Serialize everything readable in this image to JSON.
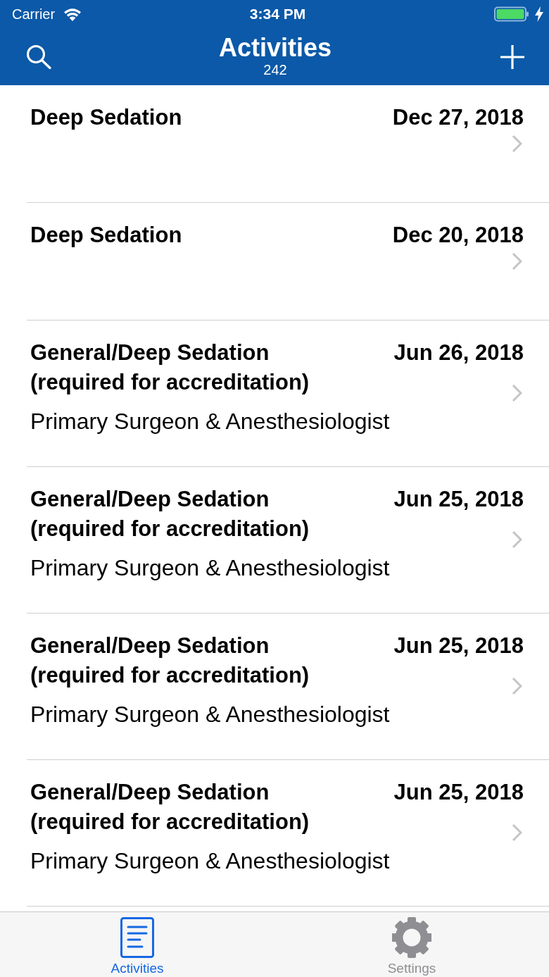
{
  "status_bar": {
    "carrier": "Carrier",
    "time": "3:34 PM"
  },
  "nav_bar": {
    "title": "Activities",
    "count": "242"
  },
  "activities": [
    {
      "title": "Deep Sedation",
      "date": "Dec 27, 2018"
    },
    {
      "title": "Deep Sedation",
      "date": "Dec 20, 2018"
    },
    {
      "title": "General/Deep Sedation (required for accreditation)",
      "date": "Jun 26, 2018",
      "role": "Primary Surgeon & Anesthesiologist"
    },
    {
      "title": "General/Deep Sedation (required for accreditation)",
      "date": "Jun 25, 2018",
      "role": "Primary Surgeon & Anesthesiologist"
    },
    {
      "title": "General/Deep Sedation (required for accreditation)",
      "date": "Jun 25, 2018",
      "role": "Primary Surgeon & Anesthesiologist"
    },
    {
      "title": "General/Deep Sedation (required for accreditation)",
      "date": "Jun 25, 2018",
      "role": "Primary Surgeon & Anesthesiologist"
    }
  ],
  "tab_bar": [
    {
      "label": "Activities",
      "kind": "document",
      "selected": true
    },
    {
      "label": "Settings",
      "kind": "gear",
      "selected": false
    }
  ]
}
